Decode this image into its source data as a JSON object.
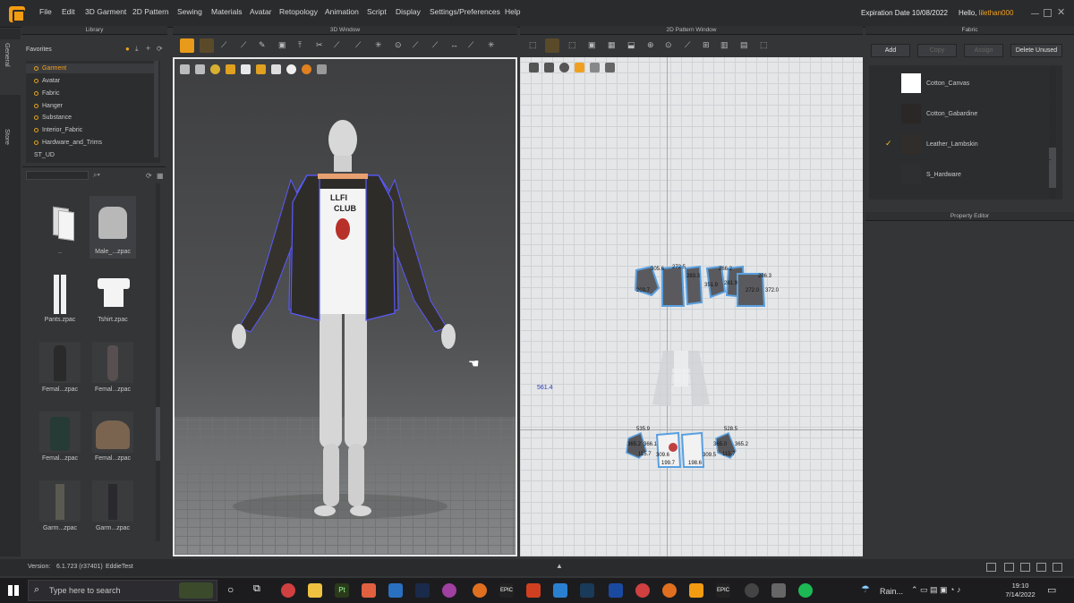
{
  "menubar": {
    "items": [
      "File",
      "Edit",
      "3D Garment",
      "2D Pattern",
      "Sewing",
      "Materials",
      "Avatar",
      "Retopology",
      "Animation",
      "Script",
      "Display",
      "Settings/Preferences",
      "Help"
    ],
    "expiration": "Expiration Date 10/08/2022",
    "hello_prefix": "Hello, ",
    "username": "lilethan000"
  },
  "sidetabs": {
    "general": "General",
    "store": "Store"
  },
  "library": {
    "title": "Library",
    "favorites": "Favorites",
    "items": [
      "Garment",
      "Avatar",
      "Fabric",
      "Hanger",
      "Substance",
      "Interior_Fabric",
      "Hardware_and_Trims"
    ],
    "extra": "ST_UD",
    "thumbs": [
      "..",
      "Male_...zpac",
      "Pants.zpac",
      "Tshirt.zpac",
      "Femal...zpac",
      "Femal...zpac",
      "Femal...zpac",
      "Femal...zpac",
      "Garm...zpac",
      "Garm...zpac"
    ]
  },
  "window3d": {
    "title": "3D Window",
    "shirt_text_1": "LLFI",
    "shirt_text_2": "CLUB"
  },
  "window2d": {
    "title": "2D Pattern Window",
    "measure_left": "561.4",
    "labels_top": [
      "203.7",
      "305.6",
      "272.5",
      "266.2",
      "286.3",
      "372.0",
      "351.9",
      "281.9",
      "272.0",
      "283.3"
    ],
    "labels_bottom": [
      "535.9",
      "528.5",
      "365.2",
      "365.0",
      "365.2",
      "115.7",
      "115.7",
      "309.6",
      "309.5",
      "199.7",
      "198.6",
      "366.1"
    ]
  },
  "fabric": {
    "title": "Fabric",
    "buttons": {
      "add": "Add",
      "copy": "Copy",
      "assign": "Assign",
      "delete": "Delete Unused"
    },
    "items": [
      {
        "name": "Cotton_Canvas",
        "color": "#ffffff",
        "checked": false
      },
      {
        "name": "Cotton_Gabardine",
        "color": "#2a2726",
        "checked": false
      },
      {
        "name": "Leather_Lambskin",
        "color": "#302d2a",
        "checked": true
      },
      {
        "name": "S_Hardware",
        "color": "#2e2f31",
        "checked": false
      }
    ]
  },
  "property_editor": {
    "title": "Property Editor"
  },
  "status": {
    "version_label": "Version:",
    "version": "6.1.723 (r37401)",
    "project": "EddieTest"
  },
  "taskbar": {
    "search_placeholder": "Type here to search",
    "weather": "Rain...",
    "time": "19:10",
    "date": "7/14/2022"
  },
  "colors": {
    "accent": "#f39c12",
    "menubar": "#2a2b2d",
    "panel": "#333537",
    "pattern_outline": "#5aa0e0"
  }
}
